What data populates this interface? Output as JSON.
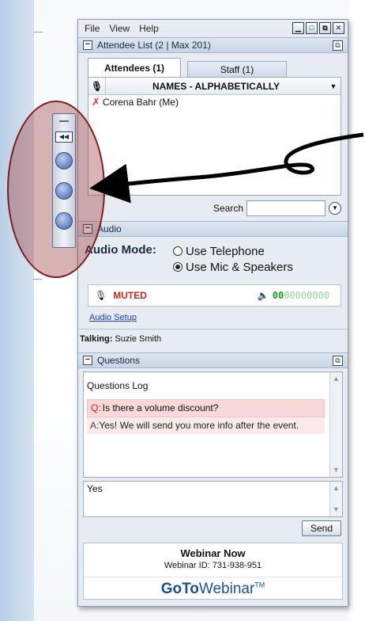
{
  "menu": {
    "items": [
      "File",
      "View",
      "Help"
    ]
  },
  "window_controls": [
    "minimize",
    "restore",
    "popout",
    "close"
  ],
  "attendee_panel": {
    "title": "Attendee List",
    "count_text": "(2 | Max 201)",
    "tabs": [
      {
        "label": "Attendees (1)",
        "active": true
      },
      {
        "label": "Staff (1)",
        "active": false
      }
    ],
    "sort_header": "NAMES - ALPHABETICALLY",
    "attendees": [
      {
        "name": "Corena Bahr (Me)",
        "status_icon": "x-mark-icon"
      }
    ],
    "search_label": "Search",
    "search_value": ""
  },
  "audio_panel": {
    "title": "Audio",
    "mode_label": "Audio Mode:",
    "options": [
      {
        "label": "Use Telephone",
        "selected": false
      },
      {
        "label": "Use Mic & Speakers",
        "selected": true
      }
    ],
    "mute_status": "MUTED",
    "level_active": "00",
    "level_inactive": "00000000",
    "setup_link": "Audio Setup",
    "talking_label": "Talking:",
    "talking_name": "Suzie Smith"
  },
  "questions_panel": {
    "title": "Questions",
    "log_title": "Questions Log",
    "question_prefix": "Q:",
    "question_text": "Is there a volume discount?",
    "answer_prefix": "A:",
    "answer_text": "Yes! We will send you more info after the event.",
    "input_value": "Yes",
    "send_label": "Send"
  },
  "footer": {
    "webinar_name": "Webinar Now",
    "webinar_id": "Webinar ID: 731-938-951",
    "brand_bold": "GoTo",
    "brand_light": "Webinar",
    "brand_tm": "TM"
  },
  "colors": {
    "muted_red": "#c7281f",
    "level_green": "#1b9a2a",
    "link_blue": "#1a3db8",
    "brand_blue": "#1d4f8f",
    "highlight_ellipse": "#7c1e1e"
  }
}
